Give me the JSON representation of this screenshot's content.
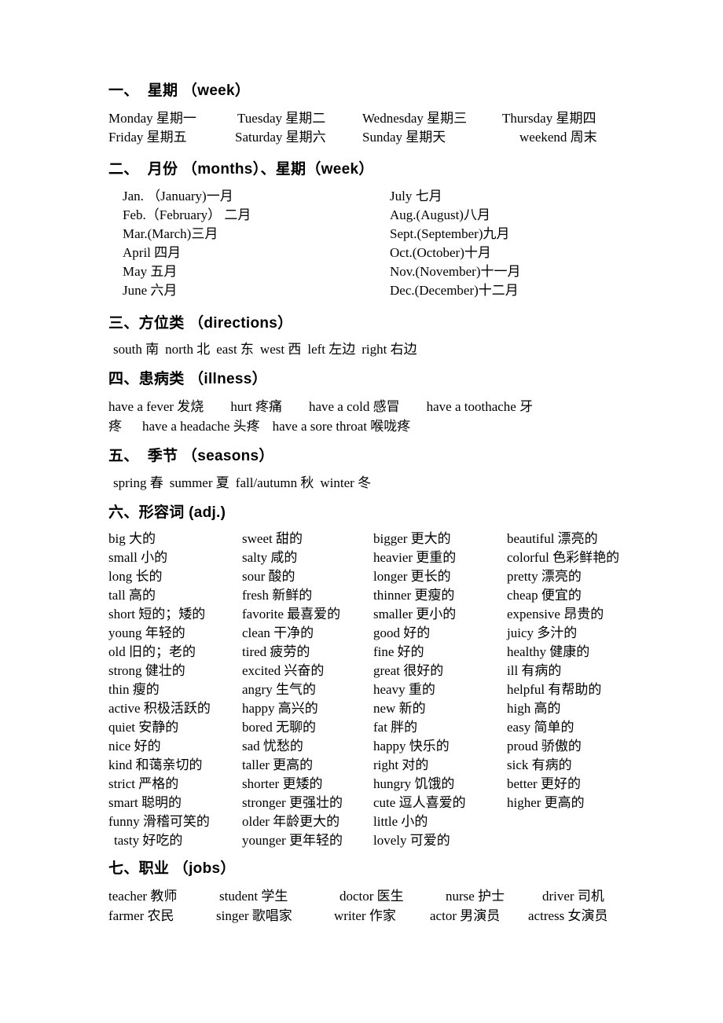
{
  "sections": {
    "week": {
      "heading": "一、  星期 （week）",
      "days": [
        "Monday 星期一",
        "Tuesday 星期二",
        "Wednesday 星期三",
        "Thursday 星期四",
        "Friday 星期五",
        "Saturday 星期六",
        "Sunday 星期天",
        "weekend 周末"
      ]
    },
    "months": {
      "heading": "二、  月份 （months）、星期（week）",
      "left": [
        "Jan. （January)一月",
        "Feb.（February） 二月",
        "Mar.(March)三月",
        "April 四月",
        "May 五月",
        "June 六月"
      ],
      "right": [
        "July 七月",
        "Aug.(August)八月",
        "Sept.(September)九月",
        "Oct.(October)十月",
        "Nov.(November)十一月",
        "Dec.(December)十二月"
      ]
    },
    "directions": {
      "heading": "三、方位类 （directions）",
      "items": [
        "south 南",
        "north 北",
        "east 东",
        "west 西",
        "left 左边",
        "right 右边"
      ]
    },
    "illness": {
      "heading": "四、患病类 （illness）",
      "line1_a": "have a fever 发烧",
      "line1_b": "hurt 疼痛",
      "line1_c": "have a cold 感冒",
      "line1_d": "have a toothache 牙",
      "line2_a": "疼",
      "line2_b": "have a headache 头疼",
      "line2_c": "have a sore throat 喉咙疼"
    },
    "seasons": {
      "heading": "五、  季节 （seasons）",
      "items": [
        "spring 春",
        "summer 夏",
        "fall/autumn 秋",
        "winter 冬"
      ]
    },
    "adjectives": {
      "heading": "六、形容词 (adj.)",
      "col1": [
        "big 大的",
        "small 小的",
        "long 长的",
        "tall 高的",
        "short 短的；矮的",
        "young 年轻的",
        "old 旧的；老的",
        "strong 健壮的",
        "thin 瘦的",
        "active 积极活跃的",
        "quiet 安静的",
        "nice 好的",
        "kind 和蔼亲切的",
        "strict 严格的",
        "smart 聪明的",
        "funny 滑稽可笑的",
        "tasty 好吃的"
      ],
      "col2": [
        "sweet 甜的",
        "salty 咸的",
        "sour 酸的",
        "fresh 新鲜的",
        "favorite 最喜爱的",
        "clean 干净的",
        "tired 疲劳的",
        "excited 兴奋的",
        "angry 生气的",
        "happy 高兴的",
        "bored 无聊的",
        "sad 忧愁的",
        "taller 更高的",
        "shorter 更矮的",
        "stronger 更强壮的",
        "older 年龄更大的",
        "younger  更年轻的"
      ],
      "col3": [
        "bigger 更大的",
        "heavier 更重的",
        "longer 更长的",
        "thinner 更瘦的",
        "smaller 更小的",
        "good 好的",
        "fine 好的",
        "great 很好的",
        "heavy  重的",
        "new 新的",
        "fat 胖的",
        "happy 快乐的",
        "right 对的",
        "hungry 饥饿的",
        "cute 逗人喜爱的",
        "little 小的",
        "lovely 可爱的"
      ],
      "col4": [
        "beautiful 漂亮的",
        "colorful   色彩鲜艳的",
        "pretty 漂亮的",
        "cheap 便宜的",
        "expensive 昂贵的",
        "juicy 多汁的",
        "healthy 健康的",
        "ill 有病的",
        "helpful 有帮助的",
        "high 高的",
        "easy 简单的",
        "proud 骄傲的",
        "sick 有病的",
        "better 更好的",
        "higher 更高的"
      ]
    },
    "jobs": {
      "heading": "七、职业 （jobs）",
      "row1": [
        "teacher 教师",
        "student 学生",
        "doctor 医生",
        "nurse 护士",
        "driver 司机"
      ],
      "row2": [
        "farmer 农民",
        "singer 歌唱家",
        "writer 作家",
        "actor 男演员",
        "actress 女演员"
      ]
    }
  }
}
